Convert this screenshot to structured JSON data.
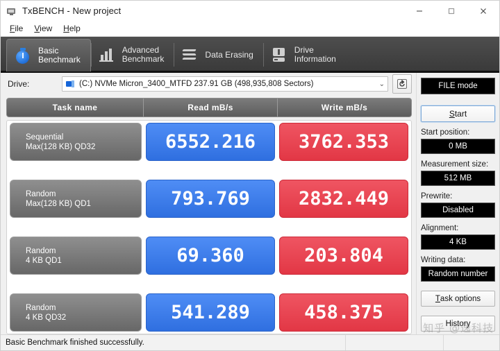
{
  "window": {
    "title": "TxBENCH - New project",
    "icon": "app-monitor-icon",
    "minimize": "—",
    "maximize": "□",
    "close": "✕"
  },
  "menu": {
    "items": [
      {
        "mnemonic": "F",
        "rest": "ile"
      },
      {
        "mnemonic": "V",
        "rest": "iew"
      },
      {
        "mnemonic": "H",
        "rest": "elp"
      }
    ]
  },
  "tabs": [
    {
      "label": "Basic\nBenchmark",
      "icon": "stopwatch-icon",
      "active": true
    },
    {
      "label": "Advanced\nBenchmark",
      "icon": "bar-chart-icon",
      "active": false
    },
    {
      "label": "Data Erasing",
      "icon": "erase-wave-icon",
      "active": false
    },
    {
      "label": "Drive\nInformation",
      "icon": "drive-info-icon",
      "active": false
    }
  ],
  "drive": {
    "label": "Drive:",
    "selected": "(C:) NVMe Micron_3400_MTFD  237.91 GB (498,935,808 Sectors)",
    "caret": "⌄",
    "refresh_icon": "refresh-icon"
  },
  "table": {
    "headers": [
      "Task name",
      "Read mB/s",
      "Write mB/s"
    ],
    "rows": [
      {
        "name_line1": "Sequential",
        "name_line2": "Max(128 KB) QD32",
        "read": "6552.216",
        "write": "3762.353"
      },
      {
        "name_line1": "Random",
        "name_line2": "Max(128 KB) QD1",
        "read": "793.769",
        "write": "2832.449"
      },
      {
        "name_line1": "Random",
        "name_line2": "4 KB QD1",
        "read": "69.360",
        "write": "203.804"
      },
      {
        "name_line1": "Random",
        "name_line2": "4 KB QD32",
        "read": "541.289",
        "write": "458.375"
      }
    ]
  },
  "sidebar": {
    "mode": "FILE mode",
    "start": "Start",
    "start_mnemonic": "S",
    "start_rest": "tart",
    "fields": [
      {
        "label": "Start position:",
        "value": "0 MB"
      },
      {
        "label": "Measurement size:",
        "value": "512 MB"
      },
      {
        "label": "Prewrite:",
        "value": "Disabled"
      },
      {
        "label": "Alignment:",
        "value": "4 KB"
      },
      {
        "label": "Writing data:",
        "value": "Random number"
      }
    ],
    "task_options_mnemonic": "T",
    "task_options_rest": "ask options",
    "history": "History"
  },
  "status": {
    "message": "Basic Benchmark finished successfully."
  },
  "watermark": {
    "text": "知乎 @逸科技"
  },
  "colors": {
    "read_accent": "#3d7ff0",
    "write_accent": "#ea4454",
    "tab_bar": "#3a3a3a",
    "value_box_bg": "#000000"
  }
}
